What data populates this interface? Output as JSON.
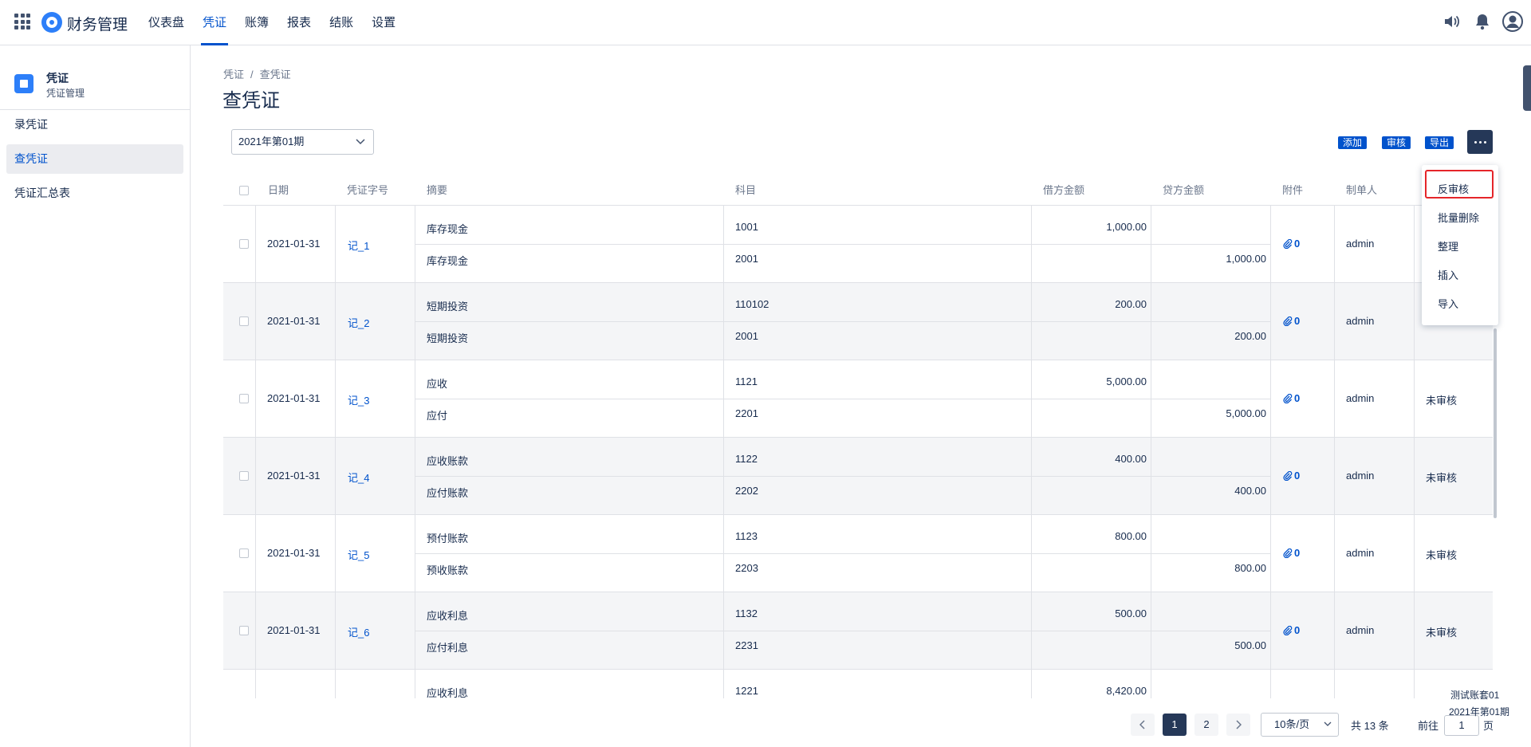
{
  "app": {
    "title": "财务管理"
  },
  "nav": [
    "仪表盘",
    "凭证",
    "账簿",
    "报表",
    "结账",
    "设置"
  ],
  "sidebar": {
    "title": "凭证",
    "subtitle": "凭证管理",
    "items": [
      "录凭证",
      "查凭证",
      "凭证汇总表"
    ]
  },
  "breadcrumb": [
    "凭证",
    "查凭证"
  ],
  "page_title": "查凭证",
  "period": "2021年第01期",
  "toolbar": {
    "add": "添加",
    "audit": "审核",
    "export": "导出"
  },
  "table": {
    "headers": [
      "日期",
      "凭证字号",
      "摘要",
      "科目",
      "借方金额",
      "贷方金额",
      "附件",
      "制单人"
    ],
    "rows": [
      {
        "date": "2021-01-31",
        "no": "记_1",
        "attach": "0",
        "maker": "admin",
        "status": "",
        "lines": [
          {
            "summary": "库存现金",
            "subject": "1001",
            "debit": "1,000.00",
            "credit": ""
          },
          {
            "summary": "库存现金",
            "subject": "2001",
            "debit": "",
            "credit": "1,000.00"
          }
        ]
      },
      {
        "date": "2021-01-31",
        "no": "记_2",
        "attach": "0",
        "maker": "admin",
        "status": "",
        "lines": [
          {
            "summary": "短期投资",
            "subject": "110102",
            "debit": "200.00",
            "credit": ""
          },
          {
            "summary": "短期投资",
            "subject": "2001",
            "debit": "",
            "credit": "200.00"
          }
        ]
      },
      {
        "date": "2021-01-31",
        "no": "记_3",
        "attach": "0",
        "maker": "admin",
        "status": "未审核",
        "lines": [
          {
            "summary": "应收",
            "subject": "1121",
            "debit": "5,000.00",
            "credit": ""
          },
          {
            "summary": "应付",
            "subject": "2201",
            "debit": "",
            "credit": "5,000.00"
          }
        ]
      },
      {
        "date": "2021-01-31",
        "no": "记_4",
        "attach": "0",
        "maker": "admin",
        "status": "未审核",
        "lines": [
          {
            "summary": "应收账款",
            "subject": "1122",
            "debit": "400.00",
            "credit": ""
          },
          {
            "summary": "应付账款",
            "subject": "2202",
            "debit": "",
            "credit": "400.00"
          }
        ]
      },
      {
        "date": "2021-01-31",
        "no": "记_5",
        "attach": "0",
        "maker": "admin",
        "status": "未审核",
        "lines": [
          {
            "summary": "预付账款",
            "subject": "1123",
            "debit": "800.00",
            "credit": ""
          },
          {
            "summary": "预收账款",
            "subject": "2203",
            "debit": "",
            "credit": "800.00"
          }
        ]
      },
      {
        "date": "2021-01-31",
        "no": "记_6",
        "attach": "0",
        "maker": "admin",
        "status": "未审核",
        "lines": [
          {
            "summary": "应收利息",
            "subject": "1132",
            "debit": "500.00",
            "credit": ""
          },
          {
            "summary": "应付利息",
            "subject": "2231",
            "debit": "",
            "credit": "500.00"
          }
        ]
      },
      {
        "date": "",
        "no": "",
        "attach": "",
        "maker": "",
        "status": "",
        "lines": [
          {
            "summary": "应收利息",
            "subject": "1221",
            "debit": "8,420.00",
            "credit": ""
          }
        ]
      }
    ]
  },
  "dropdown": [
    "反审核",
    "批量删除",
    "整理",
    "插入",
    "导入"
  ],
  "pagination": {
    "pages": [
      "1",
      "2"
    ],
    "page_size": "10条/页",
    "total": "共 13 条",
    "goto_label": "前往",
    "goto_value": "1",
    "page_unit": "页"
  },
  "footer": {
    "account": "测试账套01",
    "period": "2021年第01期"
  }
}
